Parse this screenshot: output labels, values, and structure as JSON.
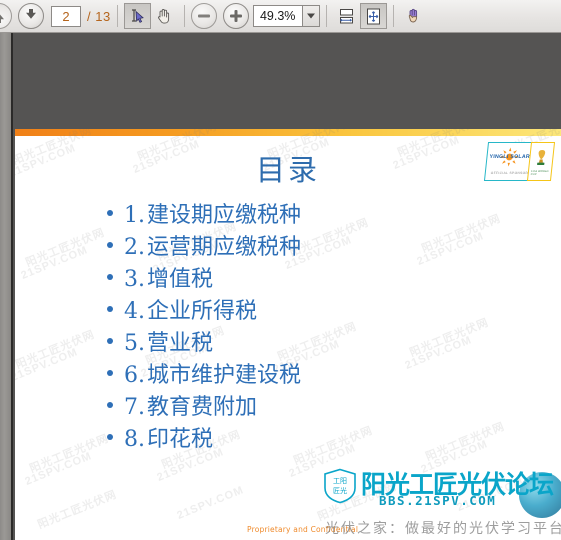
{
  "toolbar": {
    "prev_page_icon": "arrow-up-circle-icon",
    "next_page_icon": "arrow-down-circle-icon",
    "page_number": "2",
    "page_total": "/ 13",
    "select_tool_icon": "text-select-cursor-icon",
    "hand_tool_icon": "hand-pan-icon",
    "zoom_out_icon": "minus-circle-icon",
    "zoom_in_icon": "plus-circle-icon",
    "zoom_value": "49.3%",
    "zoom_dropdown_icon": "chevron-down-icon",
    "fit_width_icon": "fit-width-icon",
    "fit_page_icon": "fit-page-icon",
    "cursor_tool_icon": "hand-pointer-icon"
  },
  "slide": {
    "title": "目录",
    "toc": [
      {
        "num": "1.",
        "text": "建设期应缴税种"
      },
      {
        "num": "2.",
        "text": "运营期应缴税种"
      },
      {
        "num": "3.",
        "text": "增值税"
      },
      {
        "num": "4.",
        "text": "企业所得税"
      },
      {
        "num": "5.",
        "text": "营业税"
      },
      {
        "num": "6.",
        "text": "城市维护建设税"
      },
      {
        "num": "7.",
        "text": "教育费附加"
      },
      {
        "num": "8.",
        "text": "印花税"
      }
    ],
    "confidential_note": "Proprietary and Confidential",
    "logo": {
      "brand": "YINGLI SOLAR",
      "subtitle": "OFFICIAL SPONSOR",
      "badge_caption": "FIFA WORLD CUP"
    },
    "watermark": {
      "tile_text_a": "阳光工匠光伏网",
      "tile_text_b": "21SPV.COM",
      "shield_chars_top": "工 阳",
      "shield_chars_bottom": "匠 光",
      "forum_name": "阳光工匠光伏论坛",
      "url": "BBS.21SPV.COM",
      "tagline": "光伏之家：做最好的光伏学习平台"
    }
  },
  "colors": {
    "accent_orange": "#f08018",
    "accent_yellow": "#fce77a",
    "title_blue": "#2e6cad",
    "text_blue": "#2e6fb7",
    "viewer_bg": "#555453",
    "confidential": "#ef8a2b",
    "watermark_cyan": "#0aa5c9"
  }
}
